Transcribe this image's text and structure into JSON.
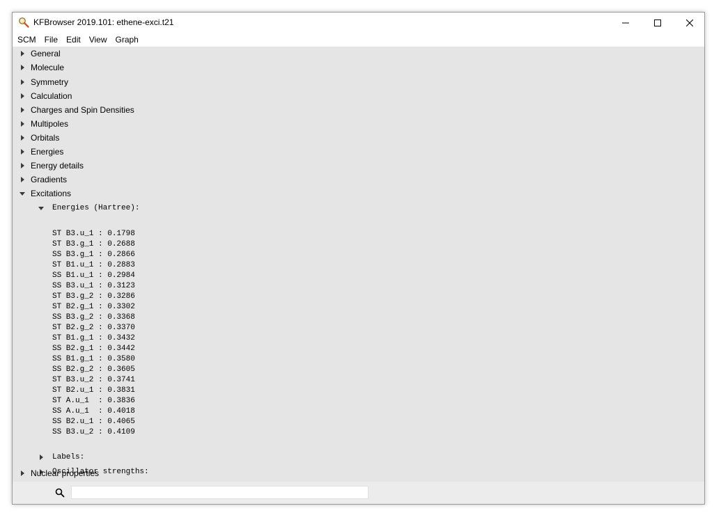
{
  "window": {
    "title": "KFBrowser 2019.101: ethene-exci.t21"
  },
  "menu": [
    "SCM",
    "File",
    "Edit",
    "View",
    "Graph"
  ],
  "tree": {
    "sections": [
      {
        "label": "General",
        "expanded": false
      },
      {
        "label": "Molecule",
        "expanded": false
      },
      {
        "label": "Symmetry",
        "expanded": false
      },
      {
        "label": "Calculation",
        "expanded": false
      },
      {
        "label": "Charges and Spin Densities",
        "expanded": false
      },
      {
        "label": "Multipoles",
        "expanded": false
      },
      {
        "label": "Orbitals",
        "expanded": false
      },
      {
        "label": "Energies",
        "expanded": false
      },
      {
        "label": "Energy details",
        "expanded": false
      },
      {
        "label": "Gradients",
        "expanded": false
      },
      {
        "label": "Excitations",
        "expanded": true
      }
    ],
    "excitations": {
      "energies_label": "Energies (Hartree):",
      "energies": [
        "ST B3.u_1 : 0.1798",
        "ST B3.g_1 : 0.2688",
        "SS B3.g_1 : 0.2866",
        "ST B1.u_1 : 0.2883",
        "SS B1.u_1 : 0.2984",
        "SS B3.u_1 : 0.3123",
        "ST B3.g_2 : 0.3286",
        "ST B2.g_1 : 0.3302",
        "SS B3.g_2 : 0.3368",
        "ST B2.g_2 : 0.3370",
        "ST B1.g_1 : 0.3432",
        "SS B2.g_1 : 0.3442",
        "SS B1.g_1 : 0.3580",
        "SS B2.g_2 : 0.3605",
        "ST B3.u_2 : 0.3741",
        "ST B2.u_1 : 0.3831",
        "ST A.u_1  : 0.3836",
        "SS A.u_1  : 0.4018",
        "SS B2.u_1 : 0.4065",
        "SS B3.u_2 : 0.4109"
      ],
      "labels_label": "Labels:",
      "oscillator_label": "Oscillator strengths:"
    },
    "nuclear": {
      "label": "Nuclear properties",
      "expanded": false
    }
  },
  "search": {
    "value": "",
    "icon": "search-icon"
  },
  "colors": {
    "content_bg": "#e5e5e5",
    "titlebar_bg": "#ffffff"
  }
}
